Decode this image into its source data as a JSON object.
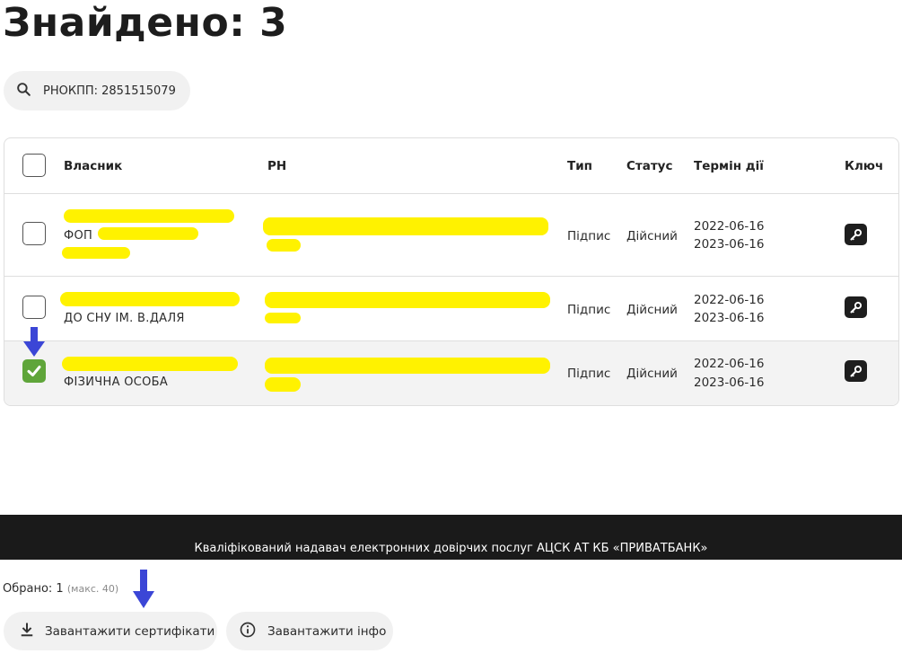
{
  "header": {
    "title": "Знайдено: 3"
  },
  "search": {
    "label": "РНОКПП: 2851515079",
    "icon": "search-icon"
  },
  "table": {
    "columns": {
      "owner": "Власник",
      "rn": "РН",
      "type": "Тип",
      "status": "Статус",
      "term": "Термін дії",
      "key": "Ключ"
    },
    "rows": [
      {
        "owner": "ФОП",
        "type": "Підпис",
        "status": "Дійсний",
        "valid_from": "2022-06-16",
        "valid_to": "2023-06-16",
        "checked": false
      },
      {
        "owner": "ДО СНУ ІМ. В.ДАЛЯ",
        "type": "Підпис",
        "status": "Дійсний",
        "valid_from": "2022-06-16",
        "valid_to": "2023-06-16",
        "checked": false
      },
      {
        "owner": "ФІЗИЧНА ОСОБА",
        "type": "Підпис",
        "status": "Дійсний",
        "valid_from": "2022-06-16",
        "valid_to": "2023-06-16",
        "checked": true
      }
    ]
  },
  "footer": {
    "provider": "Кваліфікований надавач електронних довірчих послуг АЦСК АТ КБ «ПРИВАТБАНК»"
  },
  "selection": {
    "label": "Обрано: 1",
    "max": "(макс. 40)"
  },
  "actions": {
    "download_certs": "Завантажити сертифікати",
    "download_info": "Завантажити інфо"
  },
  "colors": {
    "accent_green": "#5fa53a",
    "highlight_yellow": "#fff200",
    "annotation_blue": "#3b46d6",
    "footer_bg": "#1a1a1a"
  }
}
